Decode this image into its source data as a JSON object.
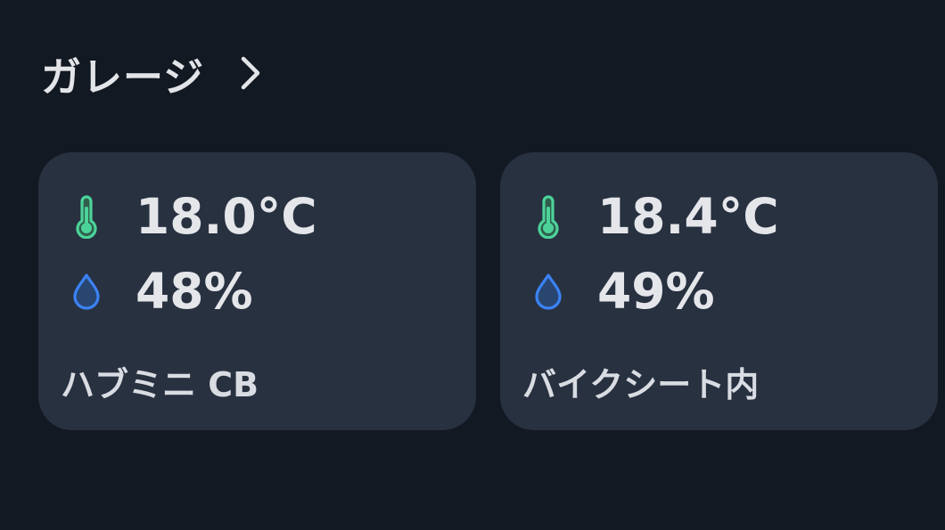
{
  "section": {
    "title": "ガレージ",
    "chevron_icon": "chevron-right-icon"
  },
  "colors": {
    "background": "#131923",
    "card_background": "#283140",
    "thermometer": "#4cd399",
    "humidity": "#3b82f6"
  },
  "cards": [
    {
      "temperature": "18.0°C",
      "humidity": "48%",
      "name": "ハブミニ CB",
      "temperature_icon": "thermometer-icon",
      "humidity_icon": "water-drop-icon"
    },
    {
      "temperature": "18.4°C",
      "humidity": "49%",
      "name": "バイクシート内",
      "temperature_icon": "thermometer-icon",
      "humidity_icon": "water-drop-icon"
    }
  ]
}
